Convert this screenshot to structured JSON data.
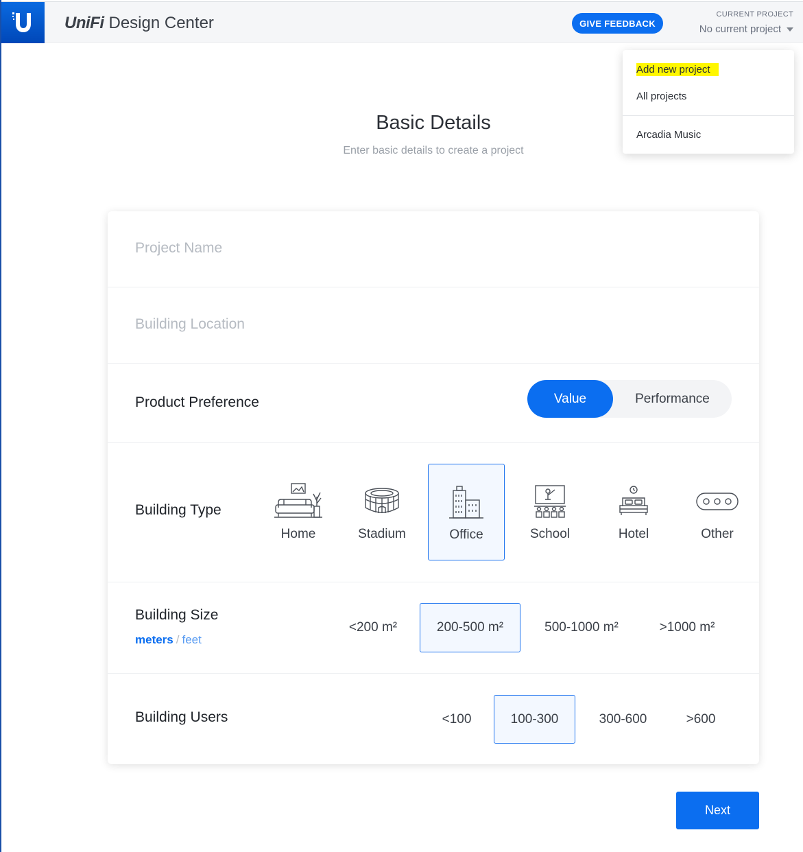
{
  "header": {
    "brand_unifi": "UniFi",
    "brand_rest": "Design Center",
    "feedback_label": "GIVE FEEDBACK",
    "current_project_label": "CURRENT PROJECT",
    "current_project_value": "No current project"
  },
  "dropdown": {
    "items": [
      {
        "label": "Add new project",
        "highlighted": true
      },
      {
        "label": "All projects"
      },
      {
        "label": "Arcadia Music"
      }
    ]
  },
  "page": {
    "title": "Basic Details",
    "subtitle": "Enter basic details to create a project"
  },
  "form": {
    "project_name_placeholder": "Project Name",
    "building_location_placeholder": "Building Location",
    "product_preference": {
      "label": "Product Preference",
      "options": [
        "Value",
        "Performance"
      ],
      "selected": "Value"
    },
    "building_type": {
      "label": "Building Type",
      "options": [
        {
          "label": "Home",
          "icon": "sofa-icon"
        },
        {
          "label": "Stadium",
          "icon": "stadium-icon"
        },
        {
          "label": "Office",
          "icon": "office-building-icon"
        },
        {
          "label": "School",
          "icon": "classroom-icon"
        },
        {
          "label": "Hotel",
          "icon": "hotel-bed-icon"
        },
        {
          "label": "Other",
          "icon": "more-dots-icon"
        }
      ],
      "selected": "Office"
    },
    "building_size": {
      "label": "Building Size",
      "unit_active": "meters",
      "unit_separator": "/",
      "unit_inactive": "feet",
      "options": [
        "<200 m²",
        "200-500 m²",
        "500-1000 m²",
        ">1000 m²"
      ],
      "selected": "200-500 m²"
    },
    "building_users": {
      "label": "Building Users",
      "options": [
        "<100",
        "100-300",
        "300-600",
        ">600"
      ],
      "selected": "100-300"
    }
  },
  "next_label": "Next",
  "colors": {
    "accent": "#0b6ef0",
    "highlight": "#fff700",
    "selected_bg": "#f3f8ff"
  }
}
